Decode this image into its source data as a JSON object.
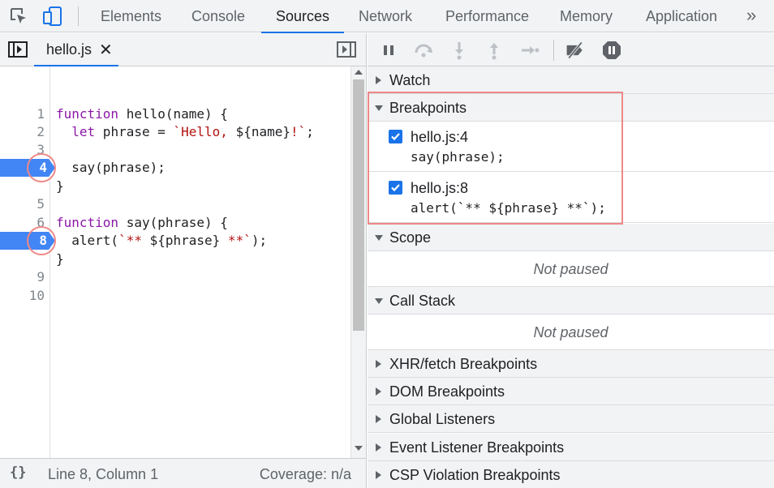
{
  "topbar": {
    "tabs": [
      "Elements",
      "Console",
      "Sources",
      "Network",
      "Performance",
      "Memory",
      "Application"
    ],
    "active_tab": "Sources",
    "more": "»"
  },
  "editor": {
    "file_name": "hello.js",
    "close_glyph": "✕",
    "line_numbers": [
      "1",
      "2",
      "3",
      "4",
      "5",
      "6",
      "7",
      "8",
      "9",
      "10"
    ],
    "breakpoint_lines": [
      "4",
      "8"
    ],
    "code": {
      "l1_kw": "function",
      "l1_rest": " hello(name) {",
      "l2_indent": "  ",
      "l2_kw": "let",
      "l2_mid": " phrase = ",
      "l2_str1": "`Hello, ",
      "l2_interp": "${name}",
      "l2_str2": "!`",
      "l2_end": ";",
      "l4": "  say(phrase);",
      "l5": "}",
      "l7_kw": "function",
      "l7_rest": " say(phrase) {",
      "l8_pre": "  alert(",
      "l8_str1": "`** ",
      "l8_interp": "${phrase}",
      "l8_str2": " **`",
      "l8_end": ");",
      "l9": "}"
    }
  },
  "status": {
    "braces": "{}",
    "position": "Line 8, Column 1",
    "coverage": "Coverage: n/a"
  },
  "debugger": {
    "watch": "Watch",
    "breakpoints": "Breakpoints",
    "bp_items": [
      {
        "location": "hello.js:4",
        "source": "say(phrase);",
        "checked": true
      },
      {
        "location": "hello.js:8",
        "source": "alert(`** ${phrase} **`);",
        "checked": true
      }
    ],
    "scope": "Scope",
    "scope_status": "Not paused",
    "call_stack": "Call Stack",
    "call_stack_status": "Not paused",
    "xhr": "XHR/fetch Breakpoints",
    "dom": "DOM Breakpoints",
    "global": "Global Listeners",
    "event": "Event Listener Breakpoints",
    "csp": "CSP Violation Breakpoints"
  },
  "colors": {
    "accent": "#1a73e8",
    "breakpoint": "#4285f4",
    "highlight": "#ee8888",
    "keyword": "#8b17a8",
    "string": "#b31412"
  },
  "icons": [
    "inspect-element-icon",
    "device-toolbar-icon",
    "toggle-navigator-icon",
    "toggle-debugger-icon",
    "pause-icon",
    "step-over-icon",
    "step-into-icon",
    "step-out-icon",
    "step-icon",
    "deactivate-breakpoints-icon",
    "pause-on-exceptions-icon"
  ]
}
